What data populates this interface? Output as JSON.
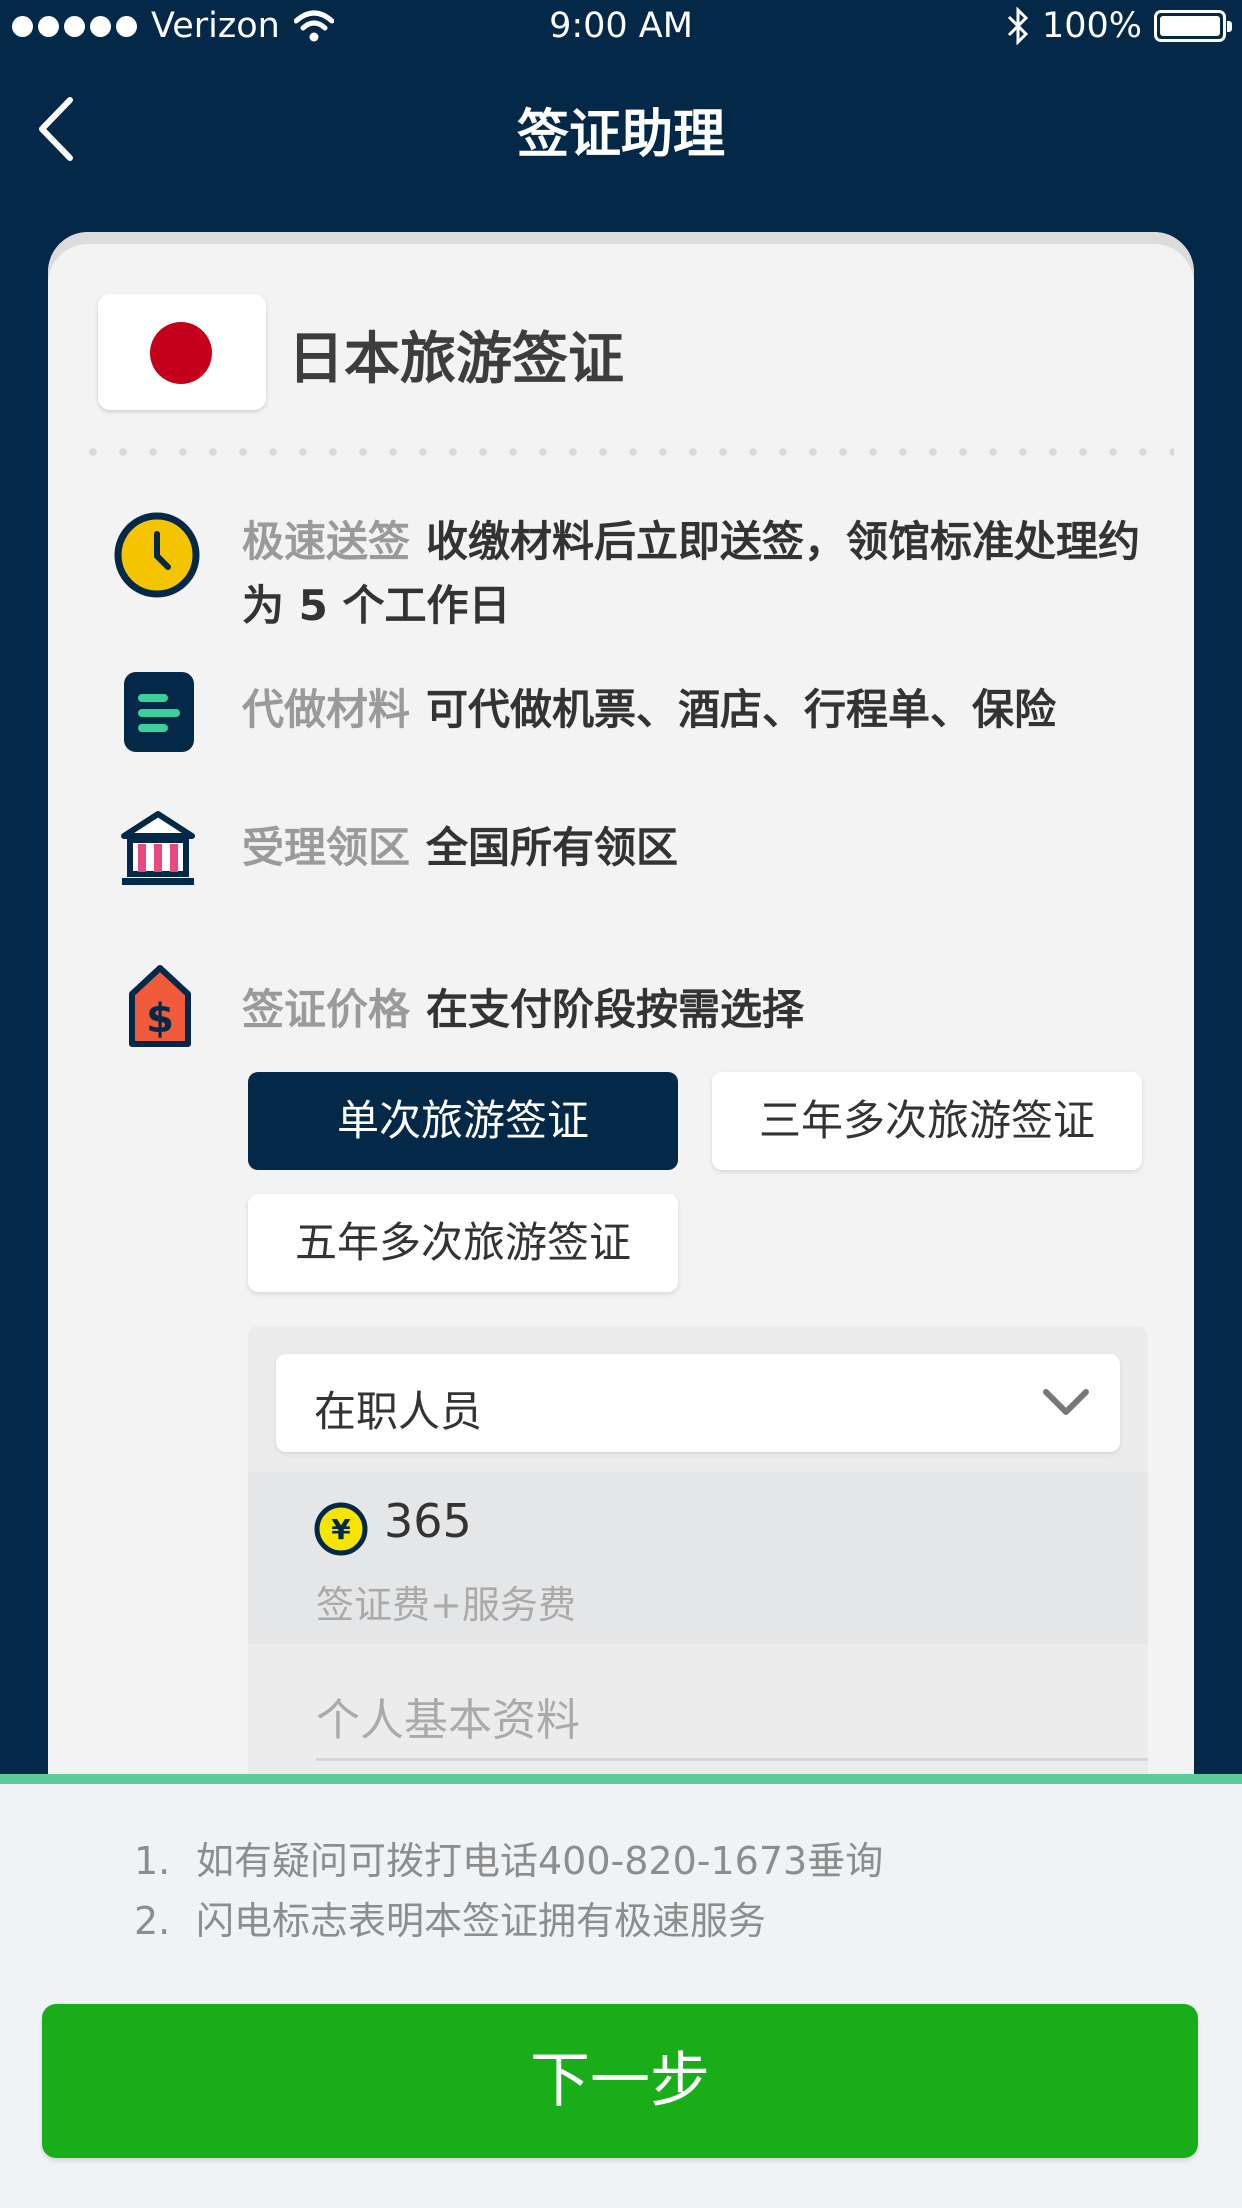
{
  "status_bar": {
    "carrier": "Verizon",
    "time": "9:00 AM",
    "battery": "100%"
  },
  "nav": {
    "title": "签证助理"
  },
  "visa": {
    "title": "日本旅游签证"
  },
  "info": [
    {
      "label": "极速送签",
      "text": "收缴材料后立即送签，领馆标准处理约为 5 个工作日",
      "icon": "clock-icon",
      "color": "#f5c400"
    },
    {
      "label": "代做材料",
      "text": "可代做机票、酒店、行程单、保险",
      "icon": "document-icon",
      "color": "#3ccf9a"
    },
    {
      "label": "受理领区",
      "text": "全国所有领区",
      "icon": "bank-icon",
      "color": "#e84a7f"
    },
    {
      "label": "签证价格",
      "text": "在支付阶段按需选择",
      "icon": "price-tag-icon",
      "color": "#f25a3c"
    }
  ],
  "options": [
    "单次旅游签证",
    "三年多次旅游签证",
    "五年多次旅游签证"
  ],
  "selected_option": "单次旅游签证",
  "applicant_type": "在职人员",
  "price": {
    "currency_icon": "yen-icon",
    "value": "365",
    "note": "签证费+服务费"
  },
  "section": {
    "label": "个人基本资料"
  },
  "notes": [
    {
      "num": "1.",
      "text": "如有疑问可拨打电话400-820-1673垂询"
    },
    {
      "num": "2.",
      "text": "闪电标志表明本签证拥有极速服务"
    }
  ],
  "next_button": "下一步",
  "colors": {
    "navy": "#042848",
    "green_button": "#1aad1a",
    "accent_line": "#5ccb9a",
    "flag_red": "#c4001a"
  }
}
